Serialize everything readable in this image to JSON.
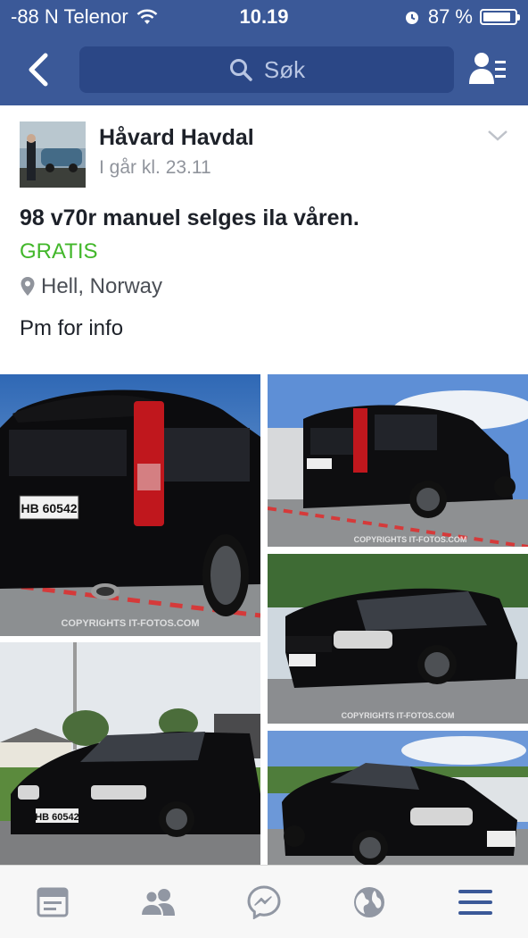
{
  "status_bar": {
    "carrier": "-88 N Telenor",
    "time": "10.19",
    "battery_text": "87 %",
    "battery_level": 0.87
  },
  "nav": {
    "search_placeholder": "Søk"
  },
  "post": {
    "author": "Håvard Havdal",
    "timestamp": "I går kl. 23.11",
    "title": "98 v70r manuel selges ila våren.",
    "price": "GRATIS",
    "location": "Hell, Norway",
    "body": "Pm for info"
  },
  "colors": {
    "header_bg": "#3b5998",
    "price_green": "#42b72a",
    "tab_active": "#3b5998",
    "tab_inactive": "#9197a3"
  },
  "photos": [
    {
      "name": "photo-rear-closeup",
      "watermark": "COPYRIGHTS IT-FOTOS.COM",
      "plate": "HB 60542"
    },
    {
      "name": "photo-rear-side",
      "watermark": "COPYRIGHTS IT-FOTOS.COM",
      "plate": "HB 60542"
    },
    {
      "name": "photo-front-side",
      "watermark": "COPYRIGHTS IT-FOTOS.COM",
      "plate": "HB 60542"
    },
    {
      "name": "photo-front-house",
      "watermark": "",
      "plate": "HB 60542"
    },
    {
      "name": "photo-front-angle",
      "watermark": "",
      "plate": "HB 6054"
    }
  ],
  "tabs": [
    {
      "icon": "news-feed-icon"
    },
    {
      "icon": "friends-icon"
    },
    {
      "icon": "messenger-icon"
    },
    {
      "icon": "globe-icon"
    },
    {
      "icon": "menu-icon"
    }
  ]
}
